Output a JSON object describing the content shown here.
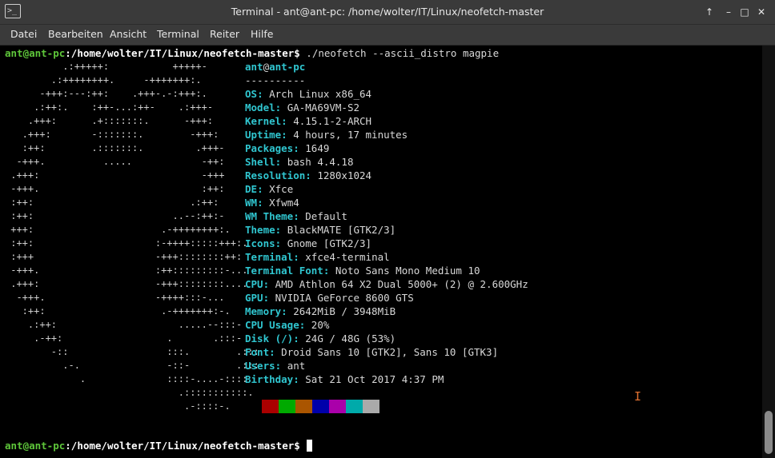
{
  "window": {
    "title": "Terminal - ant@ant-pc: /home/wolter/IT/Linux/neofetch-master",
    "app_icon_glyph": ">_",
    "buttons": {
      "up": "↑",
      "minimize": "–",
      "maximize": "□",
      "close": "✕"
    }
  },
  "menu": [
    "Datei",
    "Bearbeiten",
    "Ansicht",
    "Terminal",
    "Reiter",
    "Hilfe"
  ],
  "prompt": {
    "user_host": "ant@ant-pc",
    "path": ":/home/wolter/IT/Linux/neofetch-master$",
    "command": " ./neofetch --ascii_distro magpie"
  },
  "ascii_art": [
    "          .:+++++:           +++++-",
    "        .:++++++++.     -+++++++:.",
    "      -+++:---:++:    .+++-.-:+++:.",
    "     .:++:.    :++-...:++-    .:+++-",
    "    .+++:      .+:::::::.      -+++:",
    "   .+++:       -:::::::.        -+++:",
    "   :++:        .:::::::.         .+++-",
    "  -+++.          .....            -++:",
    " .+++:                            -+++",
    " -+++.                            :++:",
    " :++:                           .:++:",
    " :++:                        ..--:++:-",
    " +++:                      .-++++++++:.",
    " :++:                     :-++++:::::+++:.",
    " :+++                     -+++::::::::++:",
    " -+++.                    :++:::::::::-...",
    " .+++:                    -+++::::::::....",
    "  -+++.                   -++++:::-...",
    "   :++:                    .-+++++++:-.",
    "    .:++:                     .....--:::-",
    "     .-++:                  .       .:::-",
    "        -::                 :::.        .:::",
    "          .-.               -::-        .:::",
    "             .              ::::-....-::::",
    "                              .:::::::::::.",
    "                               .-::::-."
  ],
  "info_header": {
    "user": "ant",
    "at": "@",
    "host": "ant-pc",
    "separator": "----------"
  },
  "info": [
    {
      "key": "OS",
      "value": "Arch Linux x86_64"
    },
    {
      "key": "Model",
      "value": "GA-MA69VM-S2"
    },
    {
      "key": "Kernel",
      "value": "4.15.1-2-ARCH"
    },
    {
      "key": "Uptime",
      "value": "4 hours, 17 minutes"
    },
    {
      "key": "Packages",
      "value": "1649"
    },
    {
      "key": "Shell",
      "value": "bash 4.4.18"
    },
    {
      "key": "Resolution",
      "value": "1280x1024"
    },
    {
      "key": "DE",
      "value": "Xfce"
    },
    {
      "key": "WM",
      "value": "Xfwm4"
    },
    {
      "key": "WM Theme",
      "value": "Default"
    },
    {
      "key": "Theme",
      "value": "BlackMATE [GTK2/3]"
    },
    {
      "key": "Icons",
      "value": "Gnome [GTK2/3]"
    },
    {
      "key": "Terminal",
      "value": "xfce4-terminal"
    },
    {
      "key": "Terminal Font",
      "value": "Noto Sans Mono Medium 10"
    },
    {
      "key": "CPU",
      "value": "AMD Athlon 64 X2 Dual 5000+ (2) @ 2.600GHz"
    },
    {
      "key": "GPU",
      "value": "NVIDIA GeForce 8600 GTS"
    },
    {
      "key": "Memory",
      "value": "2642MiB / 3948MiB"
    },
    {
      "key": "CPU Usage",
      "value": "20%"
    },
    {
      "key": "Disk (/)",
      "value": "24G / 48G (53%)"
    },
    {
      "key": "Font",
      "value": "Droid Sans 10 [GTK2], Sans 10 [GTK3]"
    },
    {
      "key": "Users",
      "value": "ant"
    },
    {
      "key": "Birthday",
      "value": "Sat 21 Oct 2017 4:37 PM"
    }
  ],
  "key_suffix": ": ",
  "palette": [
    "#000000",
    "#aa0000",
    "#00aa00",
    "#aa5500",
    "#0000aa",
    "#aa00aa",
    "#00aaaa",
    "#aaaaaa"
  ]
}
